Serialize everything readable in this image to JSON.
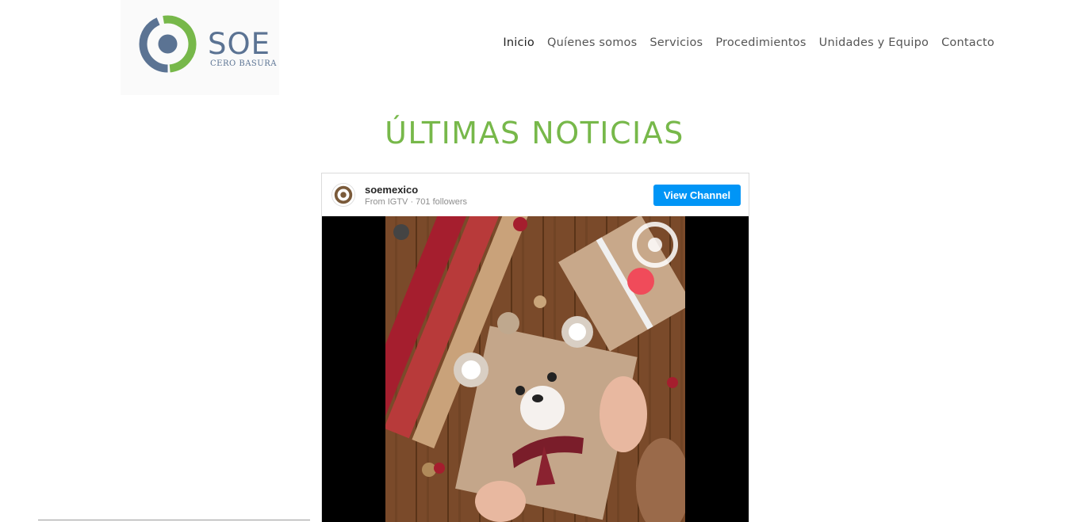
{
  "brand": {
    "name": "SOE",
    "tagline": "CERO BASURA",
    "green": "#77b84a",
    "blue": "#5b7393"
  },
  "nav": {
    "items": [
      {
        "label": "Inicio",
        "active": true
      },
      {
        "label": "Quíenes somos"
      },
      {
        "label": "Servicios"
      },
      {
        "label": "Procedimientos"
      },
      {
        "label": "Unidades y Equipo"
      },
      {
        "label": "Contacto"
      }
    ]
  },
  "section": {
    "title": "ÚLTIMAS NOTICIAS",
    "title_color": "#77b84a"
  },
  "embed": {
    "channel": "soemexico",
    "meta": "From IGTV ·  701 followers",
    "button": "View Channel",
    "button_color": "#0095f6",
    "video_icon": "gift-wrap-thumbnail"
  }
}
